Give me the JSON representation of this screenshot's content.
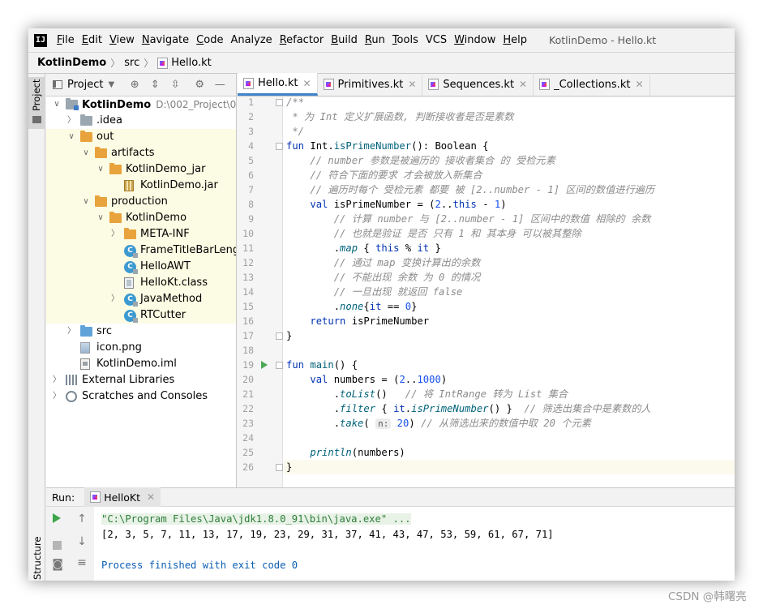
{
  "window": {
    "title": "KotlinDemo - Hello.kt",
    "app_icon": "IJ"
  },
  "menu": [
    {
      "u": "F",
      "rest": "ile"
    },
    {
      "u": "E",
      "rest": "dit"
    },
    {
      "u": "V",
      "rest": "iew"
    },
    {
      "u": "N",
      "rest": "avigate"
    },
    {
      "u": "C",
      "rest": "ode"
    },
    {
      "u": "",
      "rest": "Analyze"
    },
    {
      "u": "R",
      "rest": "efactor"
    },
    {
      "u": "B",
      "rest": "uild"
    },
    {
      "u": "R",
      "rest": "un"
    },
    {
      "u": "T",
      "rest": "ools"
    },
    {
      "u": "",
      "rest": "VCS"
    },
    {
      "u": "W",
      "rest": "indow"
    },
    {
      "u": "H",
      "rest": "elp"
    }
  ],
  "breadcrumb": {
    "project": "KotlinDemo",
    "folder": "src",
    "file": "Hello.kt"
  },
  "toolstrip": {
    "project": "Project",
    "structure": "Structure"
  },
  "project_panel": {
    "view_label": "Project",
    "tree": [
      {
        "name": "KotlinDemo",
        "path": "D:\\002_Project\\003_",
        "depth": 0,
        "arrow": "open",
        "icon": "project-folder",
        "bold": true,
        "hl": false
      },
      {
        "name": ".idea",
        "depth": 1,
        "arrow": "closed",
        "icon": "folder-grey",
        "hl": false
      },
      {
        "name": "out",
        "depth": 1,
        "arrow": "open",
        "icon": "folder-orange",
        "hl": true
      },
      {
        "name": "artifacts",
        "depth": 2,
        "arrow": "open",
        "icon": "folder-orange",
        "hl": true
      },
      {
        "name": "KotlinDemo_jar",
        "depth": 3,
        "arrow": "open",
        "icon": "folder-orange",
        "hl": true
      },
      {
        "name": "KotlinDemo.jar",
        "depth": 4,
        "arrow": "",
        "icon": "jar",
        "hl": true
      },
      {
        "name": "production",
        "depth": 2,
        "arrow": "open",
        "icon": "folder-orange",
        "hl": true
      },
      {
        "name": "KotlinDemo",
        "depth": 3,
        "arrow": "open",
        "icon": "folder-orange",
        "hl": true
      },
      {
        "name": "META-INF",
        "depth": 4,
        "arrow": "closed",
        "icon": "folder-orange",
        "hl": true
      },
      {
        "name": "FrameTitleBarLength",
        "depth": 4,
        "arrow": "",
        "icon": "class",
        "hl": true
      },
      {
        "name": "HelloAWT",
        "depth": 4,
        "arrow": "",
        "icon": "class",
        "hl": true
      },
      {
        "name": "HelloKt.class",
        "depth": 4,
        "arrow": "",
        "icon": "class-file",
        "hl": true
      },
      {
        "name": "JavaMethod",
        "depth": 4,
        "arrow": "closed",
        "icon": "class",
        "hl": true
      },
      {
        "name": "RTCutter",
        "depth": 4,
        "arrow": "",
        "icon": "class",
        "hl": true
      },
      {
        "name": "src",
        "depth": 1,
        "arrow": "closed",
        "icon": "folder-blue",
        "hl": false
      },
      {
        "name": "icon.png",
        "depth": 1,
        "arrow": "",
        "icon": "png",
        "hl": false
      },
      {
        "name": "KotlinDemo.iml",
        "depth": 1,
        "arrow": "",
        "icon": "iml",
        "hl": false
      },
      {
        "name": "External Libraries",
        "depth": 0,
        "arrow": "closed",
        "icon": "library",
        "hl": false
      },
      {
        "name": "Scratches and Consoles",
        "depth": 0,
        "arrow": "closed",
        "icon": "scratch",
        "hl": false
      }
    ]
  },
  "editor_tabs": [
    {
      "label": "Hello.kt",
      "active": true
    },
    {
      "label": "Primitives.kt",
      "active": false
    },
    {
      "label": "Sequences.kt",
      "active": false
    },
    {
      "label": "_Collections.kt",
      "active": false
    }
  ],
  "editor": {
    "lines": [
      [
        [
          "cm",
          "/**"
        ]
      ],
      [
        [
          "cm",
          " * 为 Int 定义扩展函数, 判断接收者是否是素数"
        ]
      ],
      [
        [
          "cm",
          " */"
        ]
      ],
      [
        [
          "kw",
          "fun "
        ],
        [
          "",
          "Int."
        ],
        [
          "fn",
          "isPrimeNumber"
        ],
        [
          "",
          "(): Boolean {"
        ]
      ],
      [
        [
          "",
          "    "
        ],
        [
          "cm",
          "// number 参数是被遍历的 接收者集合 的 受检元素"
        ]
      ],
      [
        [
          "",
          "    "
        ],
        [
          "cm",
          "// 符合下面的要求 才会被放入新集合"
        ]
      ],
      [
        [
          "",
          "    "
        ],
        [
          "cm",
          "// 遍历时每个 受检元素 都要 被 [2..number - 1] 区间的数值进行遍历"
        ]
      ],
      [
        [
          "",
          "    "
        ],
        [
          "kw",
          "val "
        ],
        [
          "",
          "isPrimeNumber = ("
        ],
        [
          "num",
          "2"
        ],
        [
          "",
          ".."
        ],
        [
          "kw",
          "this"
        ],
        [
          "",
          " - "
        ],
        [
          "num",
          "1"
        ],
        [
          "",
          ")"
        ]
      ],
      [
        [
          "",
          "        "
        ],
        [
          "cm",
          "// 计算 number 与 [2..number - 1] 区间中的数值 相除的 余数"
        ]
      ],
      [
        [
          "",
          "        "
        ],
        [
          "cm",
          "// 也就是验证 是否 只有 1 和 其本身 可以被其整除"
        ]
      ],
      [
        [
          "",
          "        ."
        ],
        [
          "ext",
          "map"
        ],
        [
          "",
          " { "
        ],
        [
          "kw",
          "this"
        ],
        [
          "",
          " % "
        ],
        [
          "kw",
          "it"
        ],
        [
          "",
          " }"
        ]
      ],
      [
        [
          "",
          "        "
        ],
        [
          "cm",
          "// 通过 map 变换计算出的余数"
        ]
      ],
      [
        [
          "",
          "        "
        ],
        [
          "cm",
          "// 不能出现 余数 为 0 的情况"
        ]
      ],
      [
        [
          "",
          "        "
        ],
        [
          "cm",
          "// 一旦出现 就返回 false"
        ]
      ],
      [
        [
          "",
          "        ."
        ],
        [
          "ext",
          "none"
        ],
        [
          "",
          "{"
        ],
        [
          "kw",
          "it"
        ],
        [
          "",
          " == "
        ],
        [
          "num",
          "0"
        ],
        [
          "",
          "}"
        ]
      ],
      [
        [
          "",
          "    "
        ],
        [
          "kw",
          "return "
        ],
        [
          "",
          "isPrimeNumber"
        ]
      ],
      [
        [
          "",
          "}"
        ]
      ],
      [
        [
          "",
          ""
        ]
      ],
      [
        [
          "kw",
          "fun "
        ],
        [
          "fn",
          "main"
        ],
        [
          "",
          "() {"
        ]
      ],
      [
        [
          "",
          "    "
        ],
        [
          "kw",
          "val "
        ],
        [
          "",
          "numbers = ("
        ],
        [
          "num",
          "2"
        ],
        [
          "",
          ".."
        ],
        [
          "num",
          "1000"
        ],
        [
          "",
          ")"
        ]
      ],
      [
        [
          "",
          "        ."
        ],
        [
          "ext",
          "toList"
        ],
        [
          "",
          "()   "
        ],
        [
          "cm",
          "// 将 IntRange 转为 List 集合"
        ]
      ],
      [
        [
          "",
          "        ."
        ],
        [
          "ext",
          "filter"
        ],
        [
          "",
          " { "
        ],
        [
          "kw",
          "it"
        ],
        [
          "",
          "."
        ],
        [
          "ext",
          "isPrimeNumber"
        ],
        [
          "",
          "() }  "
        ],
        [
          "cm",
          "// 筛选出集合中是素数的人"
        ]
      ],
      [
        [
          "",
          "        ."
        ],
        [
          "ext",
          "take"
        ],
        [
          "",
          "( "
        ],
        [
          "hint",
          "n:"
        ],
        [
          "num",
          " 20"
        ],
        [
          "",
          ") "
        ],
        [
          "cm",
          "// 从筛选出来的数值中取 20 个元素"
        ]
      ],
      [
        [
          "",
          ""
        ]
      ],
      [
        [
          "",
          "    "
        ],
        [
          "ext",
          "println"
        ],
        [
          "",
          "(numbers)"
        ]
      ],
      [
        [
          "",
          "}"
        ]
      ]
    ],
    "current_line": 26,
    "run_line": 19
  },
  "run_panel": {
    "label": "Run:",
    "tab": "HelloKt",
    "console": [
      "\"C:\\Program Files\\Java\\jdk1.8.0_91\\bin\\java.exe\" ...",
      "[2, 3, 5, 7, 11, 13, 17, 19, 23, 29, 31, 37, 41, 43, 47, 53, 59, 61, 67, 71]",
      "",
      "Process finished with exit code 0"
    ]
  },
  "watermark": "CSDN @韩曙亮"
}
